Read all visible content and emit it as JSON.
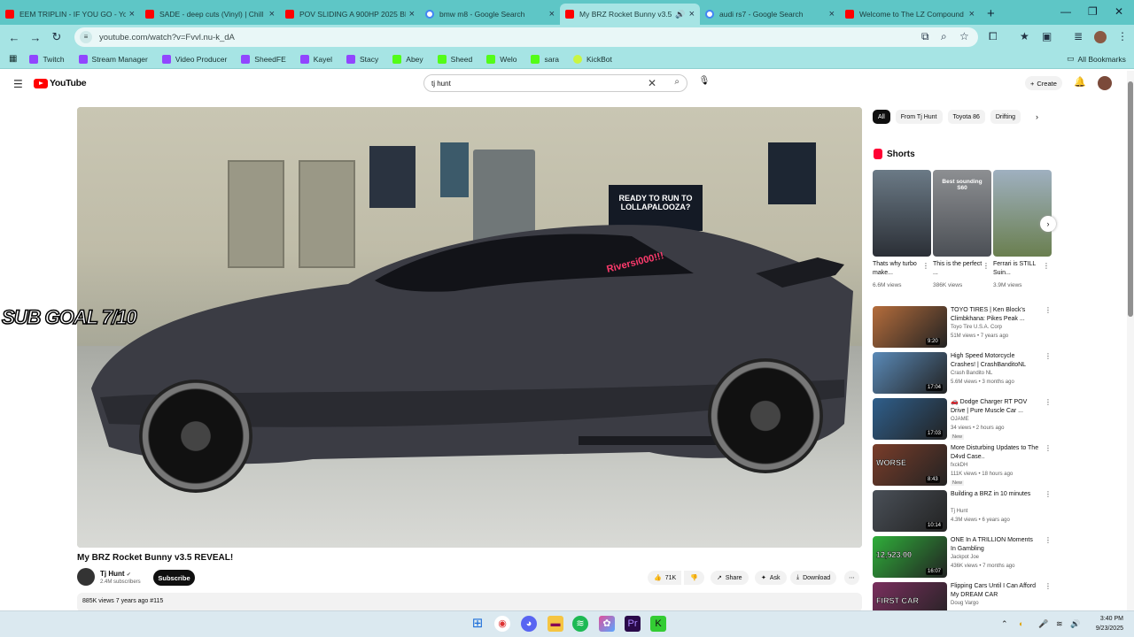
{
  "browser": {
    "tabs": [
      {
        "title": "EEM TRIPLIN - IF YOU GO - You",
        "icon": "youtube-icon"
      },
      {
        "title": "SADE - deep cuts (Vinyl) | Chill",
        "icon": "youtube-icon"
      },
      {
        "title": "POV SLIDING A 900HP 2025 BM",
        "icon": "youtube-icon"
      },
      {
        "title": "bmw m8 - Google Search",
        "icon": "google-icon"
      },
      {
        "title": "My BRZ Rocket Bunny v3.5",
        "icon": "youtube-icon",
        "active": true
      },
      {
        "title": "audi rs7 - Google Search",
        "icon": "google-icon"
      },
      {
        "title": "Welcome to The LZ Compound",
        "icon": "youtube-icon"
      }
    ],
    "url": "youtube.com/watch?v=Fvvl.nu-k_dA",
    "bookmarks": [
      {
        "label": "Twitch",
        "icon": "twitch-icon"
      },
      {
        "label": "Stream Manager",
        "icon": "twitch-icon"
      },
      {
        "label": "Video Producer",
        "icon": "twitch-icon"
      },
      {
        "label": "SheedFE",
        "icon": "twitch-icon"
      },
      {
        "label": "Kayel",
        "icon": "twitch-icon"
      },
      {
        "label": "Stacy",
        "icon": "twitch-icon"
      },
      {
        "label": "Abey",
        "icon": "kick-icon"
      },
      {
        "label": "Sheed",
        "icon": "kick-icon"
      },
      {
        "label": "Welo",
        "icon": "kick-icon"
      },
      {
        "label": "sara",
        "icon": "kick-icon"
      },
      {
        "label": "KickBot",
        "icon": "kickbot-icon"
      }
    ],
    "all_bookmarks": "All Bookmarks"
  },
  "youtube": {
    "logo": "YouTube",
    "search_value": "tj hunt",
    "create_label": "Create",
    "overlay_text": "SUB GOAL 7/10",
    "video_sign": "READY TO RUN TO LOLLAPALOOZA?",
    "sticker": "Riversi000!!!",
    "video": {
      "title": "My BRZ Rocket Bunny v3.5 REVEAL!",
      "channel": "Tj Hunt",
      "subscribers": "2.4M subscribers",
      "subscribe_label": "Subscribe",
      "likes": "71K",
      "share": "Share",
      "ask": "Ask",
      "download": "Download",
      "meta": "885K views  7 years ago  #115"
    },
    "chips": [
      "All",
      "From Tj Hunt",
      "Toyota 86",
      "Drifting"
    ],
    "shorts_heading": "Shorts",
    "shorts": [
      {
        "title": "Thats why turbo make...",
        "views": "6.6M views"
      },
      {
        "title": "This is the perfect ...",
        "views": "386K views",
        "overlay": "Best sounding S60"
      },
      {
        "title": "Ferrari is STILL Suin...",
        "views": "3.9M views"
      }
    ],
    "recommended": [
      {
        "title": "TOYO TIRES | Ken Block's Climbkhana: Pikes Peak ...",
        "channel": "Toyo Tire U.S.A. Corp",
        "views": "51M views • 7 years ago",
        "duration": "9:20",
        "badge": "",
        "color": "#b56d3c"
      },
      {
        "title": "High Speed Motorcycle Crashes! | CrashBanditoNL",
        "channel": "Crash Bandito NL",
        "views": "5.6M views • 3 months ago",
        "duration": "17:04",
        "badge": "",
        "color": "#5a8ab8"
      },
      {
        "title": "🚗 Dodge Charger RT POV Drive | Pure Muscle Car ...",
        "channel": "OJAME",
        "views": "34 views • 2 hours ago",
        "duration": "17:03",
        "badge": "New",
        "color": "#2f5f8c"
      },
      {
        "title": "More Disturbing Updates to The D4vd Case..",
        "channel": "fxckDH",
        "views": "111K views • 18 hours ago",
        "duration": "8:43",
        "badge": "New",
        "color": "#7a3d2a",
        "overlay": "WORSE"
      },
      {
        "title": "Building a BRZ in 10 minutes",
        "channel": "Tj Hunt",
        "views": "4.3M views • 6 years ago",
        "duration": "10:14",
        "badge": "",
        "color": "#4a5058"
      },
      {
        "title": "ONE In A TRILLION Moments In Gambling",
        "channel": "Jackpot Joe",
        "views": "436K views • 7 months ago",
        "duration": "16:07",
        "badge": "",
        "color": "#2fae3a",
        "overlay": "12,523.00"
      },
      {
        "title": "Flipping Cars Until I Can Afford My DREAM CAR",
        "channel": "Doug Vargo",
        "views": "",
        "duration": "",
        "badge": "",
        "color": "#7a2f5e",
        "overlay": "FIRST CAR"
      }
    ]
  },
  "taskbar": {
    "time": "3:40 PM",
    "date": "9/23/2025"
  }
}
